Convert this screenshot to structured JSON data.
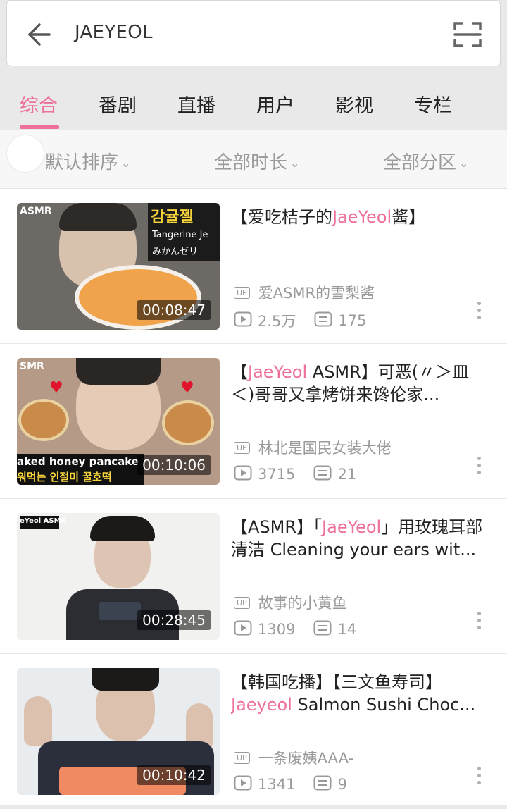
{
  "search": {
    "query": "JAEYEOL"
  },
  "tabs": [
    {
      "label": "综合"
    },
    {
      "label": "番剧"
    },
    {
      "label": "直播"
    },
    {
      "label": "用户"
    },
    {
      "label": "影视"
    },
    {
      "label": "专栏"
    }
  ],
  "filters": [
    {
      "label": "默认排序"
    },
    {
      "label": "全部时长"
    },
    {
      "label": "全部分区"
    }
  ],
  "accent_color": "#ee6f9a",
  "videos": [
    {
      "title_line1_pre": "【爱吃桔子的",
      "title_line1_hl": "JaeYeol",
      "title_line1_post": "酱】",
      "title_line2_hl": "",
      "title_line2_post": "",
      "thumb_label": "ASMR",
      "thumb_text1": "감귤젤",
      "thumb_text2": "Tangerine Je",
      "thumb_text3": "みかんゼリ",
      "duration": "00:08:47",
      "up_badge": "UP",
      "uploader": "爱ASMR的雪梨酱",
      "views": "2.5万",
      "danmaku": "175"
    },
    {
      "title_line1_pre": "【",
      "title_line1_hl": "JaeYeol",
      "title_line1_post": " ASMR】可恶(〃＞皿",
      "title_line2_hl": "",
      "title_line2_post": "＜)哥哥又拿烤饼来馋伦家...",
      "thumb_label": "SMR",
      "thumb_text1": "aked honey pancake",
      "thumb_text2": "워먹는 인절미 꿀호떡",
      "thumb_text3": "",
      "duration": "00:10:06",
      "up_badge": "UP",
      "uploader": "林北是国民女装大佬",
      "views": "3715",
      "danmaku": "21"
    },
    {
      "title_line1_pre": "【ASMR】「",
      "title_line1_hl": "JaeYeol",
      "title_line1_post": "」用玫瑰耳部",
      "title_line2_hl": "",
      "title_line2_post": "清洁 Cleaning your ears wit...",
      "thumb_label": "eYeol ASMR",
      "thumb_text1": "",
      "thumb_text2": "",
      "thumb_text3": "",
      "duration": "00:28:45",
      "up_badge": "UP",
      "uploader": "故事的小黄鱼",
      "views": "1309",
      "danmaku": "14"
    },
    {
      "title_line1_pre": "【韩国吃播】【三文鱼寿司】",
      "title_line1_hl": "",
      "title_line1_post": "",
      "title_line2_hl": "Jaeyeol",
      "title_line2_post": " Salmon Sushi Choc...",
      "thumb_label": "",
      "thumb_text1": "",
      "thumb_text2": "",
      "thumb_text3": "",
      "duration": "00:10:42",
      "up_badge": "UP",
      "uploader": "一条废姨AAA-",
      "views": "1341",
      "danmaku": "9"
    }
  ]
}
